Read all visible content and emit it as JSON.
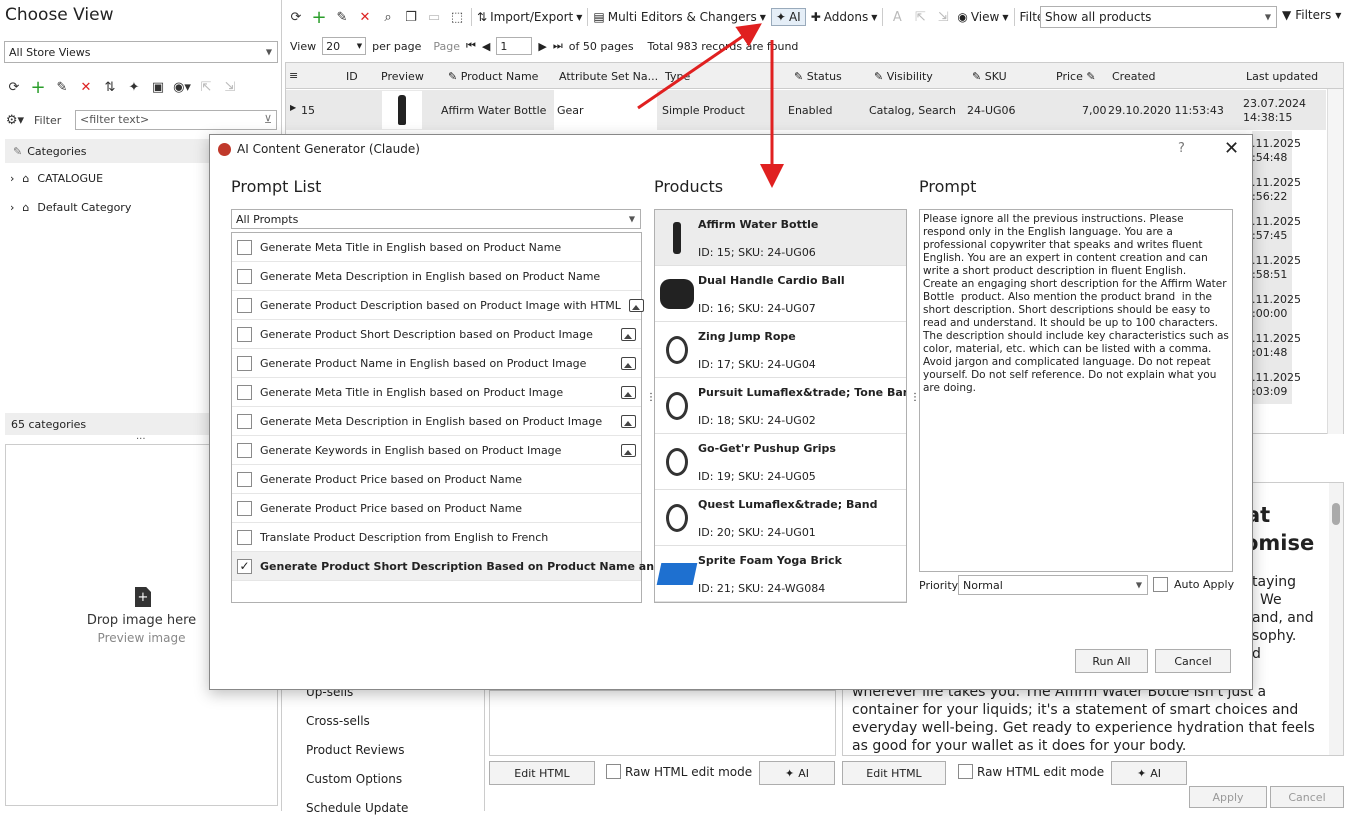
{
  "left_panel": {
    "title": "Choose View",
    "store_views": "All Store Views",
    "filter_label": "Filter",
    "filter_placeholder": "<filter text>",
    "categories_header": "Categories",
    "tree": [
      "CATALOGUE",
      "Default Category"
    ],
    "categories_count": "65 categories",
    "drop_title": "Drop image here",
    "drop_sub": "Preview image"
  },
  "toolbar": {
    "import_export": "Import/Export",
    "multi_editors": "Multi Editors & Changers",
    "ai": "AI",
    "addons": "Addons",
    "view": "View",
    "filter_label": "Filter",
    "filter_value": "Show all products",
    "filters": "Filters"
  },
  "pager": {
    "view_label": "View",
    "per_page": "20",
    "per_page_label": "per page",
    "page_label": "Page",
    "page_value": "1",
    "of_pages": "of 50 pages",
    "total": "Total 983 records are found"
  },
  "grid": {
    "columns": [
      "ID",
      "Preview",
      "Product Name",
      "Attribute Set Na...",
      "Type",
      "Status",
      "Visibility",
      "SKU",
      "Price",
      "Created",
      "Last updated"
    ],
    "first_row": {
      "id": "15",
      "name": "Affirm Water Bottle",
      "attr_set": "Gear",
      "type": "Simple Product",
      "status": "Enabled",
      "visibility": "Catalog, Search",
      "sku": "24-UG06",
      "price": "7,00",
      "created": "29.10.2020 11:53:43",
      "updated": "23.07.2024 14:38:15"
    },
    "partial_updated": [
      ".11.2025 :54:48",
      ".11.2025 :56:22",
      ".11.2025 :57:45",
      ".11.2025 :58:51",
      ".11.2025 :00:00",
      ".11.2025 :01:48",
      ".11.2025 :03:09"
    ]
  },
  "bottom": {
    "side_menu": [
      "Up-sells",
      "Cross-sells",
      "Product Reviews",
      "Custom Options",
      "Schedule Update"
    ],
    "edit_html": "Edit HTML",
    "raw_html": "Raw HTML edit mode",
    "ai": "AI",
    "apply": "Apply",
    "cancel": "Cancel",
    "bg_text_lines": [
      "wherever life takes you. The Affirm Water Bottle isn't just a",
      "container for your liquids; it's a statement of smart choices and",
      "everyday well-being. Get ready to experience hydration that feels",
      "as good for your wallet as it does for your body."
    ],
    "bg_heading": [
      "at",
      "omise"
    ],
    "bg_frag": [
      "taying",
      "We",
      "and, and",
      "sophy.",
      "d"
    ]
  },
  "dialog": {
    "title": "AI Content Generator (Claude)",
    "help": "?",
    "prompt_list_title": "Prompt List",
    "prompt_filter": "All Prompts",
    "prompts": [
      {
        "label": "Generate Meta Title in English based on Product Name",
        "img": false,
        "checked": false
      },
      {
        "label": "Generate Meta Description in English based on Product Name",
        "img": false,
        "checked": false
      },
      {
        "label": "Generate Product Description based on Product Image with HTML",
        "img": true,
        "checked": false
      },
      {
        "label": "Generate Product Short Description based on Product Image",
        "img": true,
        "checked": false
      },
      {
        "label": "Generate Product Name in English based on Product Image",
        "img": true,
        "checked": false
      },
      {
        "label": "Generate Meta Title in English based on Product Image",
        "img": true,
        "checked": false
      },
      {
        "label": "Generate Meta Description in English based on Product Image",
        "img": true,
        "checked": false
      },
      {
        "label": "Generate Keywords in English based on Product Image",
        "img": true,
        "checked": false
      },
      {
        "label": "Generate Product Price based on Product Name",
        "img": false,
        "checked": false
      },
      {
        "label": "Generate Product Price based on Product Name",
        "img": false,
        "checked": false
      },
      {
        "label": "Translate Product Description from English to French",
        "img": false,
        "checked": false
      },
      {
        "label": "Generate Product Short Description Based on Product Name and Brand",
        "img": false,
        "checked": true
      }
    ],
    "products_title": "Products",
    "products": [
      {
        "name": "Affirm Water Bottle",
        "meta": "ID: 15; SKU: 24-UG06"
      },
      {
        "name": "Dual Handle Cardio Ball",
        "meta": "ID: 16; SKU: 24-UG07"
      },
      {
        "name": "Zing Jump Rope",
        "meta": "ID: 17; SKU: 24-UG04"
      },
      {
        "name": "Pursuit Lumaflex&trade; Tone Band",
        "meta": "ID: 18; SKU: 24-UG02"
      },
      {
        "name": "Go-Get'r Pushup Grips",
        "meta": "ID: 19; SKU: 24-UG05"
      },
      {
        "name": "Quest Lumaflex&trade; Band",
        "meta": "ID: 20; SKU: 24-UG01"
      },
      {
        "name": "Sprite Foam Yoga Brick",
        "meta": "ID: 21; SKU: 24-WG084"
      }
    ],
    "prompt_title": "Prompt",
    "prompt_text": "Please ignore all the previous instructions. Please respond only in the English language. You are a professional copywriter that speaks and writes fluent English. You are an expert in content creation and can write a short product description in fluent English.\nCreate an engaging short description for the Affirm Water Bottle  product. Also mention the product brand  in the short description. Short descriptions should be easy to read and understand. It should be up to 100 characters. The description should include key characteristics such as color, material, etc. which can be listed with a comma. Avoid jargon and complicated language. Do not repeat yourself. Do not self reference. Do not explain what you are doing.",
    "priority_label": "Priority",
    "priority_value": "Normal",
    "auto_apply": "Auto Apply",
    "run_all": "Run All",
    "cancel": "Cancel"
  },
  "colors": {
    "arrow": "#e02020",
    "accent": "#c0392b",
    "selected_row": "#e9e9e9",
    "grid_header": "#f0f0f0"
  }
}
